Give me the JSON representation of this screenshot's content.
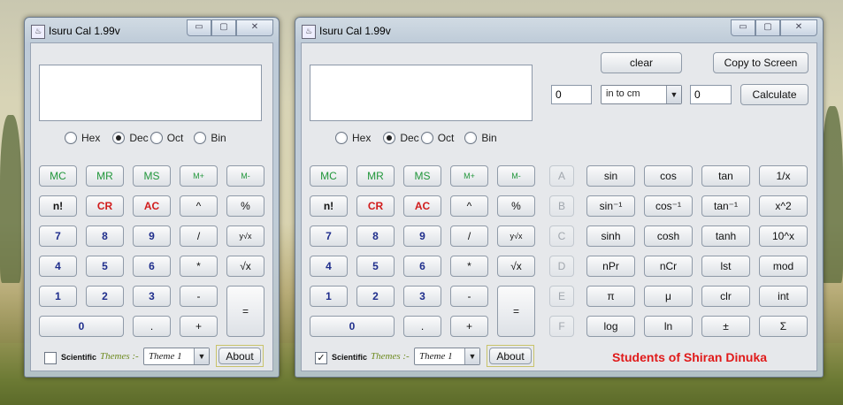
{
  "window_title": "Isuru Cal 1.99v",
  "titlebar_buttons": {
    "minimize": "▭",
    "maximize": "▢",
    "close": "✕"
  },
  "radios": [
    "Hex",
    "Dec",
    "Oct",
    "Bin"
  ],
  "radio_selected": "Dec",
  "memory_row": [
    "MC",
    "MR",
    "MS",
    "M+",
    "M-"
  ],
  "row2": [
    "n!",
    "CR",
    "AC",
    "^",
    "%"
  ],
  "row3": [
    "7",
    "8",
    "9",
    "/",
    "y√x"
  ],
  "row4": [
    "4",
    "5",
    "6",
    "*",
    "√x"
  ],
  "row5": [
    "1",
    "2",
    "3",
    "-"
  ],
  "row6": [
    "0",
    ".",
    "+"
  ],
  "equals": "=",
  "scientific_label": "Scientific",
  "themes_label": "Themes :-",
  "theme_value": "Theme 1",
  "about_label": "About",
  "left_window": {
    "scientific_checked": false
  },
  "right_window": {
    "scientific_checked": true,
    "clear_label": "clear",
    "copy_label": "Copy to Screen",
    "conv_input": "0",
    "conv_unit": "in to cm",
    "conv_output": "0",
    "calculate_label": "Calculate",
    "hex_letters": [
      "A",
      "B",
      "C",
      "D",
      "E",
      "F"
    ],
    "sci_rows": [
      [
        "sin",
        "cos",
        "tan",
        "1/x"
      ],
      [
        "sin⁻¹",
        "cos⁻¹",
        "tan⁻¹",
        "x^2"
      ],
      [
        "sinh",
        "cosh",
        "tanh",
        "10^x"
      ],
      [
        "nPr",
        "nCr",
        "lst",
        "mod"
      ],
      [
        "π",
        "μ",
        "clr",
        "int"
      ],
      [
        "log",
        "ln",
        "±",
        "Σ"
      ]
    ],
    "credit": "Students of Shiran Dinuka"
  },
  "check_mark": "✓",
  "combo_arrow": "▼"
}
